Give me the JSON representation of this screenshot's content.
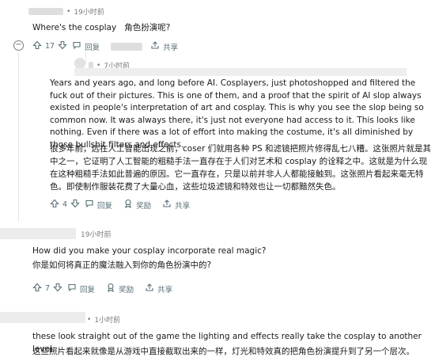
{
  "comments": [
    {
      "time": "19小时前",
      "text_en": "Where's the cosplay",
      "text_cn": "角色扮演呢?",
      "votes": "17",
      "reply": "回复",
      "share": "共享",
      "collapse": "−"
    },
    {
      "time": "7小时前",
      "text_en": "Years and years ago, and long before AI. Cosplayers, just photoshopped and filtered the fuck out of their pictures. This is one of them, and a proof that the spirit of AI slop always existed in people's interpretation of art and cosplay. This is why you see the slop being so common now. It was always there, it's just not everyone had access to it. This looks like nothing. Even if there was a lot of effort into making the costume, it's all diminished by those bullshit filters and effects.",
      "text_cn": "很多年前，远在人工智能出现之前，coser 们就用各种 PS 和滤镜把照片修得乱七八糟。这张照片就是其中之一，它证明了人工智能的粗糙手法一直存在于人们对艺术和 cosplay 的诠释之中。这就是为什么现在这种粗糙手法如此普遍的原因。它一直存在，只是以前并非人人都能接触到。这张照片看起来毫无特色。即使制作服装花费了大量心血，这些垃圾滤镜和特效也让一切都黯然失色。",
      "votes": "4",
      "reply": "回复",
      "award": "奖励",
      "share": "共享"
    },
    {
      "time": "19小时前",
      "text_en": "How did you make your cosplay incorporate real magic?",
      "text_cn": "你是如何将真正的魔法融入到你的角色扮演中的?",
      "votes": "7",
      "reply": "回复",
      "award": "奖励",
      "share": "共享"
    },
    {
      "time": "1小时前",
      "text_en": "these look straight out of the game the lighting and effects really take the cosplay to another level.",
      "text_cn": "这些照片看起来就像是从游戏中直接截取出来的一样，灯光和特效真的把角色扮演提升到了另一个层次。"
    }
  ],
  "icons": {
    "upvote": "arrow-up-icon",
    "downvote": "arrow-down-icon",
    "reply": "comment-bubble-icon",
    "award": "award-icon",
    "share": "share-icon"
  }
}
